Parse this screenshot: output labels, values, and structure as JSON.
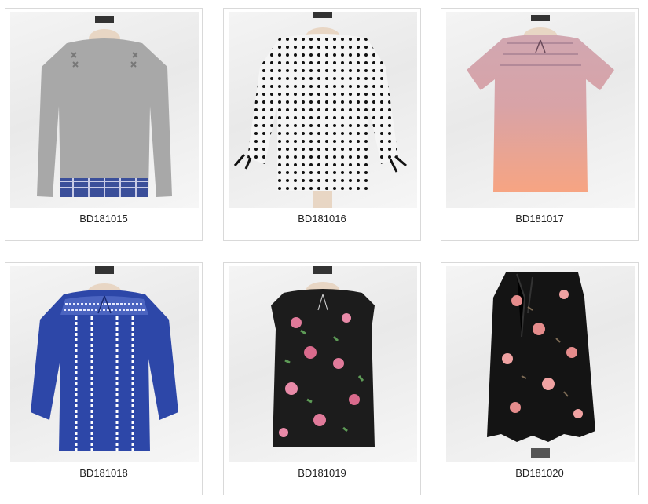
{
  "products": [
    {
      "code": "BD181015",
      "colors": {
        "main": "#a8a8a8",
        "accent": "#3b4f9a"
      }
    },
    {
      "code": "BD181016",
      "colors": {
        "main": "#f5f5f5",
        "accent": "#111111"
      }
    },
    {
      "code": "BD181017",
      "colors": {
        "main": "#e0a9a4",
        "accent": "#f2a07e"
      }
    },
    {
      "code": "BD181018",
      "colors": {
        "main": "#2d47a8",
        "accent": "#ffffff"
      }
    },
    {
      "code": "BD181019",
      "colors": {
        "main": "#1c1c1c",
        "accent": "#e07a9a"
      }
    },
    {
      "code": "BD181020",
      "colors": {
        "main": "#141414",
        "accent": "#e58c8c"
      }
    }
  ]
}
